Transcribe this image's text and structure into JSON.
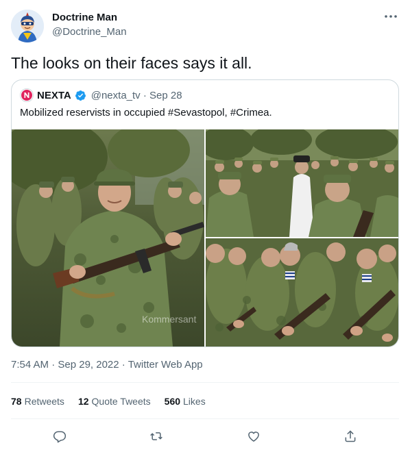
{
  "author": {
    "name": "Doctrine Man",
    "handle": "@Doctrine_Man",
    "avatar_icon": "superhero-cartoon-avatar"
  },
  "tweet": {
    "text": "The looks on their faces says it all."
  },
  "quoted": {
    "name": "NEXTA",
    "handle": "@nexta_tv · Sep 28",
    "text": "Mobilized reservists in occupied #Sevastopol, #Crimea.",
    "verified_color": "#1d9bf0",
    "media": [
      {
        "icon": "photo-older-reservist-holding-rifle",
        "watermark": "Kommersant"
      },
      {
        "icon": "photo-reservists-with-priest"
      },
      {
        "icon": "photo-reservists-in-line-with-rifles"
      }
    ]
  },
  "meta": {
    "time": "7:54 AM · Sep 29, 2022",
    "separator": " · ",
    "source": "Twitter Web App"
  },
  "stats": {
    "retweets_count": "78",
    "retweets_label": "Retweets",
    "quotes_count": "12",
    "quotes_label": "Quote Tweets",
    "likes_count": "560",
    "likes_label": "Likes"
  },
  "actions": {
    "reply_icon": "reply-icon",
    "retweet_icon": "retweet-icon",
    "like_icon": "like-icon",
    "share_icon": "share-icon"
  },
  "colors": {
    "text": "#0f1419",
    "secondary": "#536471",
    "border": "#cfd9de",
    "accent": "#1d9bf0",
    "brand_red": "#e0245e"
  }
}
